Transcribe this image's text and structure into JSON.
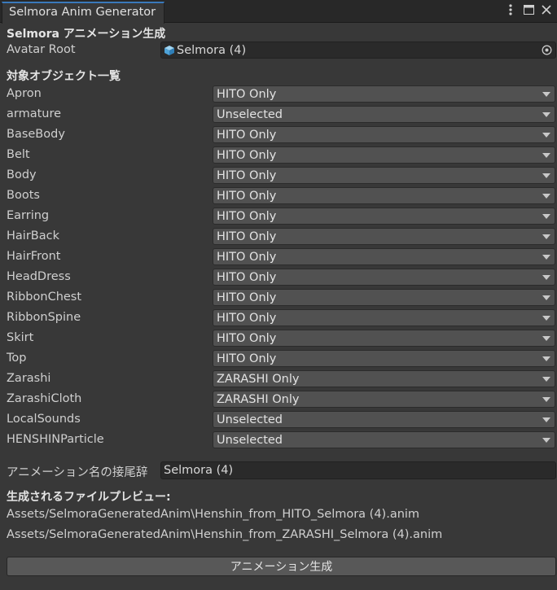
{
  "window": {
    "tab_title": "Selmora Anim Generator",
    "icons": [
      "more-vert-icon",
      "maximize-icon",
      "close-icon"
    ]
  },
  "header": {
    "title": "Selmora アニメーション生成"
  },
  "avatar_root": {
    "label": "Avatar Root",
    "value": "Selmora (4)"
  },
  "objects": {
    "heading": "対象オブジェクト一覧",
    "rows": [
      {
        "name": "Apron",
        "value": "HITO Only"
      },
      {
        "name": "armature",
        "value": "Unselected"
      },
      {
        "name": "BaseBody",
        "value": "HITO Only"
      },
      {
        "name": "Belt",
        "value": "HITO Only"
      },
      {
        "name": "Body",
        "value": "HITO Only"
      },
      {
        "name": "Boots",
        "value": "HITO Only"
      },
      {
        "name": "Earring",
        "value": "HITO Only"
      },
      {
        "name": "HairBack",
        "value": "HITO Only"
      },
      {
        "name": "HairFront",
        "value": "HITO Only"
      },
      {
        "name": "HeadDress",
        "value": "HITO Only"
      },
      {
        "name": "RibbonChest",
        "value": "HITO Only"
      },
      {
        "name": "RibbonSpine",
        "value": "HITO Only"
      },
      {
        "name": "Skirt",
        "value": "HITO Only"
      },
      {
        "name": "Top",
        "value": "HITO Only"
      },
      {
        "name": "Zarashi",
        "value": "ZARASHI Only"
      },
      {
        "name": "ZarashiCloth",
        "value": "ZARASHI Only"
      },
      {
        "name": "LocalSounds",
        "value": "Unselected"
      },
      {
        "name": "HENSHINParticle",
        "value": "Unselected"
      }
    ]
  },
  "suffix": {
    "label": "アニメーション名の接尾辞",
    "value": "Selmora (4)"
  },
  "preview": {
    "heading": "生成されるファイルプレビュー:",
    "files": [
      "Assets/SelmoraGeneratedAnim\\Henshin_from_HITO_Selmora (4).anim",
      "Assets/SelmoraGeneratedAnim\\Henshin_from_ZARASHI_Selmora (4).anim"
    ]
  },
  "generate_button": {
    "label": "アニメーション生成"
  }
}
